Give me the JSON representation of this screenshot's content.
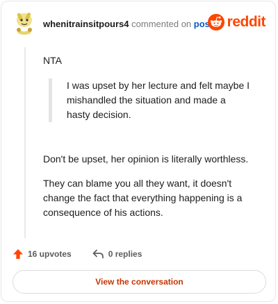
{
  "header": {
    "username": "whenitrainsitpours4",
    "action_text": "commented on",
    "post_link": "post",
    "brand_name": "reddit"
  },
  "comment": {
    "opening": "NTA",
    "quote_lines": [
      "I was upset by her lecture and felt maybe I",
      "mishandled the situation and made a",
      "hasty decision."
    ],
    "paragraph_two": "Don't be upset, her opinion is literally worthless.",
    "paragraph_three_lines": [
      "They can blame you all they want, it doesn't",
      "change the fact that everything happening is a",
      "consequence of his actions."
    ]
  },
  "footer": {
    "upvotes": "16 upvotes",
    "replies": "0 replies"
  },
  "cta_label": "View the conversation",
  "colors": {
    "accent": "#ff4500",
    "link": "#0a5bbd",
    "cta_text": "#c53500"
  }
}
